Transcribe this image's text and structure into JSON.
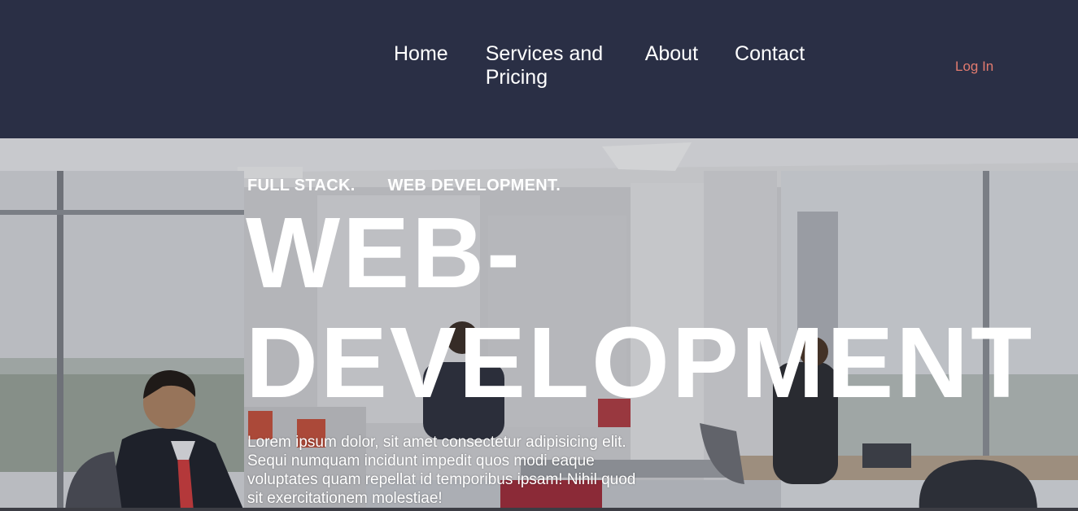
{
  "nav": {
    "items": [
      {
        "label": "Home"
      },
      {
        "label": "Services and Pricing"
      },
      {
        "label": "About"
      },
      {
        "label": "Contact"
      }
    ],
    "login_label": "Log In"
  },
  "hero": {
    "tagline": [
      "FULL STACK.",
      "WEB DEVELOPMENT."
    ],
    "headline_line1": "WEB-",
    "headline_line2": "DEVELOPMENT",
    "body": "Lorem ipsum dolor, sit amet consectetur adipisicing elit. Sequi numquam incidunt impedit quos modi eaque voluptates quam repellat id temporibus ipsam! Nihil quod sit exercitationem molestiae!"
  },
  "colors": {
    "header_bg": "#2a2f45",
    "login_accent": "#e27b6f",
    "text": "#ffffff"
  }
}
